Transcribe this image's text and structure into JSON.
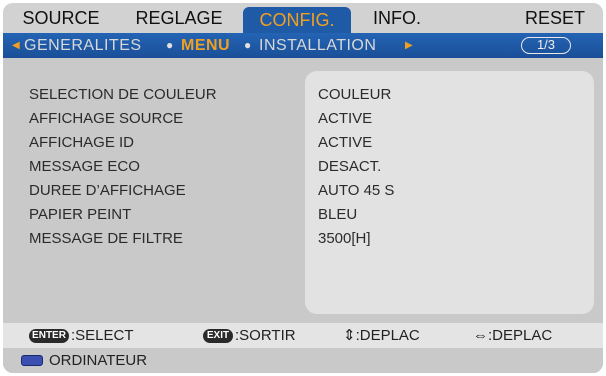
{
  "tabs": [
    {
      "label": "SOURCE"
    },
    {
      "label": "REGLAGE"
    },
    {
      "label": "CONFIG."
    },
    {
      "label": "INFO."
    },
    {
      "label": "RESET"
    }
  ],
  "active_tab": "CONFIG.",
  "subtabs": [
    {
      "label": "GENERALITES"
    },
    {
      "label": "MENU"
    },
    {
      "label": "INSTALLATION"
    }
  ],
  "active_subtab": "MENU",
  "page_indicator": "1/3",
  "settings": [
    {
      "label": "SELECTION DE COULEUR",
      "value": "COULEUR"
    },
    {
      "label": "AFFICHAGE SOURCE",
      "value": "ACTIVE"
    },
    {
      "label": "AFFICHAGE ID",
      "value": "ACTIVE"
    },
    {
      "label": "MESSAGE ECO",
      "value": "DESACT."
    },
    {
      "label": "DUREE D’AFFICHAGE",
      "value": "AUTO 45 S"
    },
    {
      "label": "PAPIER PEINT",
      "value": "BLEU"
    },
    {
      "label": "MESSAGE DE FILTRE",
      "value": "3500[H]"
    }
  ],
  "help": {
    "enter_key": "ENTER",
    "enter_text": ":SELECT",
    "exit_key": "EXIT",
    "exit_text": ":SORTIR",
    "updown_text": "⇕:DEPLAC",
    "leftright_text": "⇔:DEPLAC"
  },
  "source": {
    "icon": "monitor-icon",
    "label": "ORDINATEUR"
  },
  "colors": {
    "accent": "#f0a020",
    "tab_bar_blue": "#1f5aa6"
  }
}
